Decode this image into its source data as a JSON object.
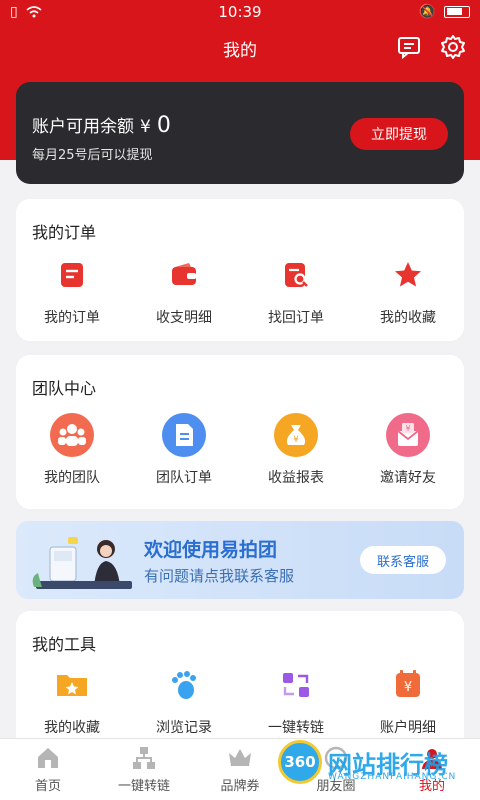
{
  "status_bar": {
    "time": "10:39"
  },
  "header": {
    "title": "我的"
  },
  "balance": {
    "label": "账户可用余额",
    "currency": "¥",
    "value": "0",
    "note": "每月25号后可以提现",
    "withdraw_label": "立即提现"
  },
  "orders": {
    "title": "我的订单",
    "items": [
      {
        "label": "我的订单",
        "icon": "order-list-icon",
        "color": "#e8342f"
      },
      {
        "label": "收支明细",
        "icon": "wallet-icon",
        "color": "#e8342f"
      },
      {
        "label": "找回订单",
        "icon": "search-order-icon",
        "color": "#e8342f"
      },
      {
        "label": "我的收藏",
        "icon": "star-icon",
        "color": "#e8342f"
      }
    ]
  },
  "team": {
    "title": "团队中心",
    "items": [
      {
        "label": "我的团队",
        "icon": "team-icon",
        "color": "#f26a4f"
      },
      {
        "label": "团队订单",
        "icon": "document-icon",
        "color": "#4d8ef0"
      },
      {
        "label": "收益报表",
        "icon": "money-bag-icon",
        "color": "#f5a623"
      },
      {
        "label": "邀请好友",
        "icon": "invite-envelope-icon",
        "color": "#f06a8a"
      }
    ]
  },
  "banner": {
    "title": "欢迎使用易拍团",
    "subtitle": "有问题请点我联系客服",
    "button_label": "联系客服"
  },
  "tools": {
    "title": "我的工具",
    "items": [
      {
        "label": "我的收藏",
        "icon": "folder-star-icon",
        "color": "#f5a623"
      },
      {
        "label": "浏览记录",
        "icon": "footprint-icon",
        "color": "#3aa3f0"
      },
      {
        "label": "一键转链",
        "icon": "convert-link-icon",
        "color": "#9b59e6"
      },
      {
        "label": "账户明细",
        "icon": "account-detail-icon",
        "color": "#f06a3a"
      }
    ]
  },
  "tabbar": {
    "items": [
      {
        "label": "首页",
        "icon": "home-icon"
      },
      {
        "label": "一键转链",
        "icon": "link-tree-icon"
      },
      {
        "label": "品牌券",
        "icon": "crown-icon"
      },
      {
        "label": "朋友圈",
        "icon": "moments-icon"
      },
      {
        "label": "我的",
        "icon": "profile-icon"
      }
    ]
  },
  "watermark": {
    "circle_text": "360",
    "text": "网站排行榜",
    "sub": "WANGZHANPAIHANG.CN"
  },
  "colors": {
    "brand_red": "#d8151a",
    "card_dark": "#2a2a2f"
  }
}
